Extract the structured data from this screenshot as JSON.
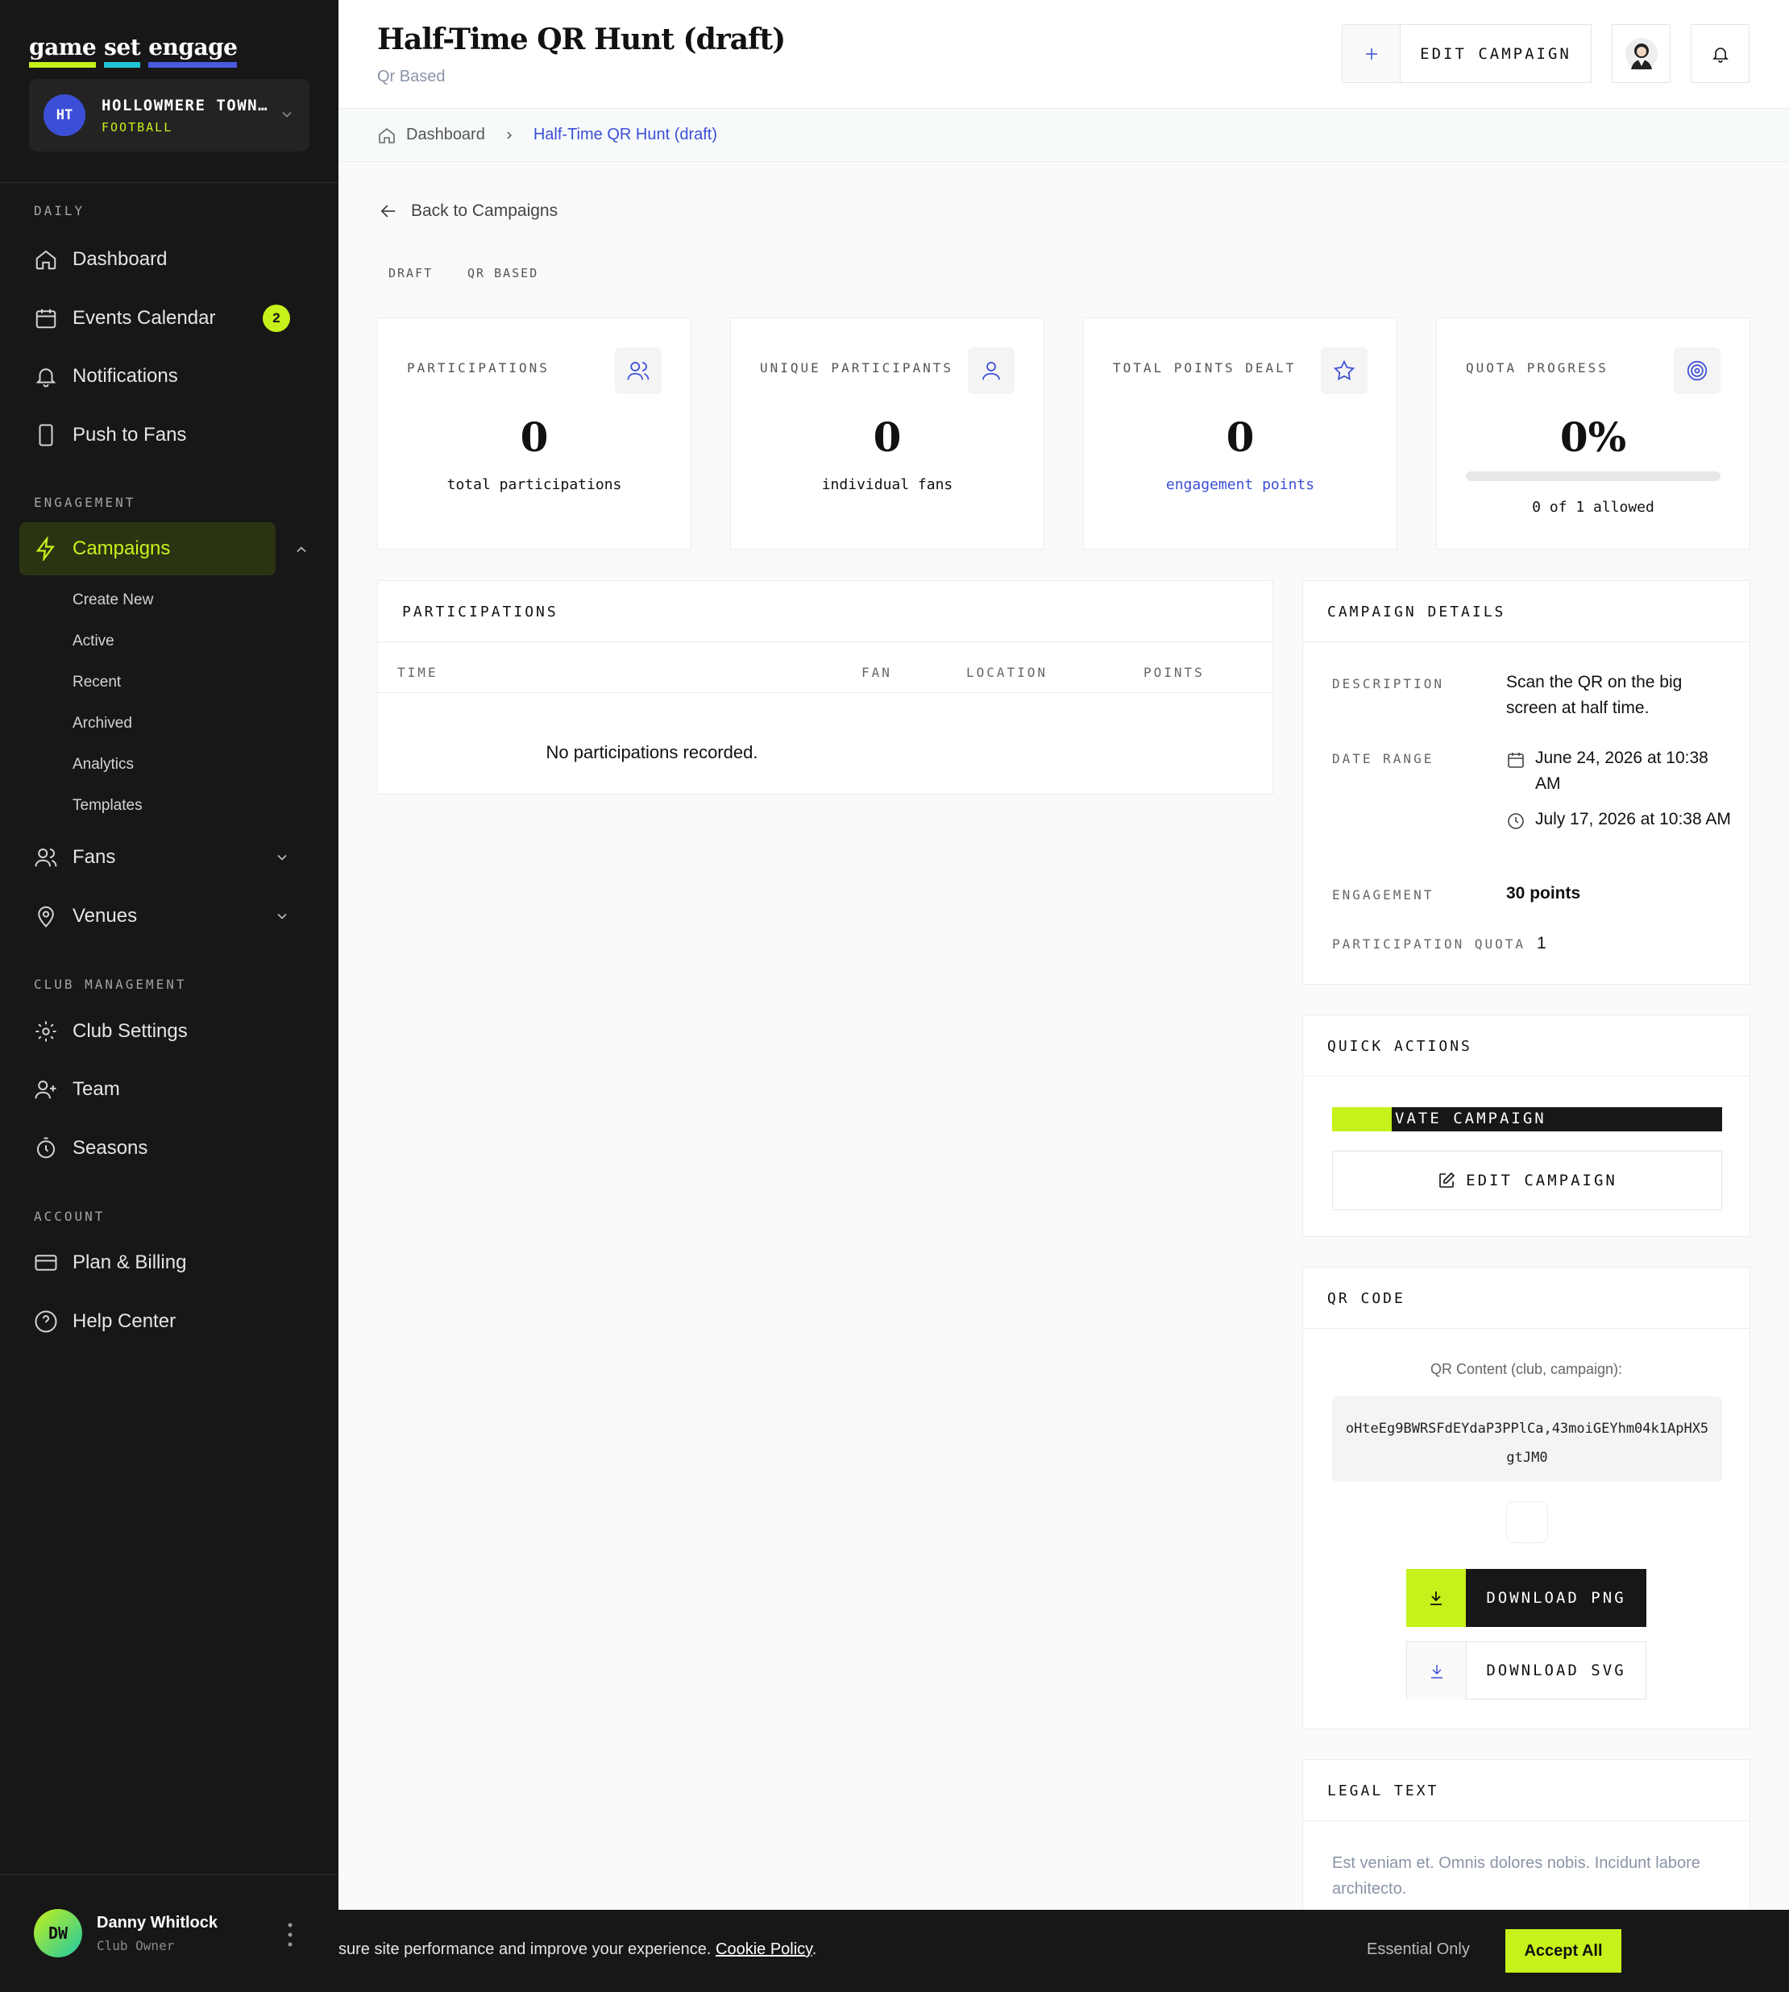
{
  "brand": {
    "word1": "game",
    "word2": "set",
    "word3": "engage"
  },
  "club": {
    "initials": "HT",
    "name": "HOLLOWMERE TOWN…",
    "sport": "FOOTBALL"
  },
  "sidebar": {
    "daily_label": "DAILY",
    "daily": [
      {
        "label": "Dashboard",
        "icon": "home-icon"
      },
      {
        "label": "Events Calendar",
        "icon": "calendar-icon",
        "badge": "2"
      },
      {
        "label": "Notifications",
        "icon": "bell-icon"
      },
      {
        "label": "Push to Fans",
        "icon": "phone-icon"
      }
    ],
    "engagement_label": "ENGAGEMENT",
    "campaigns_label": "Campaigns",
    "campaign_subs": [
      "Create New",
      "Active",
      "Recent",
      "Archived",
      "Analytics",
      "Templates"
    ],
    "fans_label": "Fans",
    "venues_label": "Venues",
    "club_label": "CLUB MANAGEMENT",
    "club_items": [
      {
        "label": "Club Settings",
        "icon": "gear-icon"
      },
      {
        "label": "Team",
        "icon": "user-plus-icon"
      },
      {
        "label": "Seasons",
        "icon": "timer-icon"
      }
    ],
    "account_label": "ACCOUNT",
    "account_items": [
      {
        "label": "Plan & Billing",
        "icon": "credit-card-icon"
      },
      {
        "label": "Help Center",
        "icon": "help-circle-icon"
      }
    ]
  },
  "user": {
    "initials": "DW",
    "name": "Danny Whitlock",
    "role": "Club Owner"
  },
  "header": {
    "title": "Half-Time QR Hunt (draft)",
    "subtitle": "Qr Based",
    "edit_label": "EDIT CAMPAIGN"
  },
  "breadcrumb": {
    "home": "Dashboard",
    "current": "Half-Time QR Hunt (draft)"
  },
  "back_label": "Back to Campaigns",
  "tags": [
    "DRAFT",
    "QR BASED"
  ],
  "stats": [
    {
      "label": "PARTICIPATIONS",
      "value": "0",
      "caption": "total participations"
    },
    {
      "label": "UNIQUE PARTICIPANTS",
      "value": "0",
      "caption": "individual fans"
    },
    {
      "label": "TOTAL POINTS DEALT",
      "value": "0",
      "caption": "engagement points"
    },
    {
      "label": "QUOTA PROGRESS",
      "value": "0%",
      "caption": "0 of 1 allowed",
      "progress": 0
    }
  ],
  "participations": {
    "title": "PARTICIPATIONS",
    "columns": [
      "TIME",
      "FAN",
      "LOCATION",
      "POINTS"
    ],
    "empty": "No participations recorded."
  },
  "details": {
    "title": "CAMPAIGN DETAILS",
    "description_label": "DESCRIPTION",
    "description": "Scan the QR on the big screen at half time.",
    "date_label": "DATE RANGE",
    "start": "June 24, 2026 at 10:38 AM",
    "end": "July 17, 2026 at 10:38 AM",
    "engagement_label": "ENGAGEMENT",
    "engagement": "30 points",
    "quota_label": "PARTICIPATION QUOTA",
    "quota": "1"
  },
  "quick_actions": {
    "title": "QUICK ACTIONS",
    "activate": "VATE CAMPAIGN",
    "edit": "EDIT CAMPAIGN"
  },
  "qr": {
    "title": "QR CODE",
    "caption": "QR Content (club, campaign):",
    "content": "oHteEg9BWRSFdEYdaP3PPlCa,43moiGEYhm04k1ApHX5gtJM0",
    "png": "DOWNLOAD PNG",
    "svg": "DOWNLOAD SVG"
  },
  "legal": {
    "title": "LEGAL TEXT",
    "text": "Est veniam et. Omnis dolores nobis. Incidunt labore architecto."
  },
  "cookie": {
    "message": "sure site performance and improve your experience.",
    "link": "Cookie Policy",
    "essential": "Essential Only",
    "accept": "Accept All"
  },
  "colors": {
    "accent": "#c6f11a",
    "link": "#3b4fd6",
    "sidebar": "#171717"
  }
}
